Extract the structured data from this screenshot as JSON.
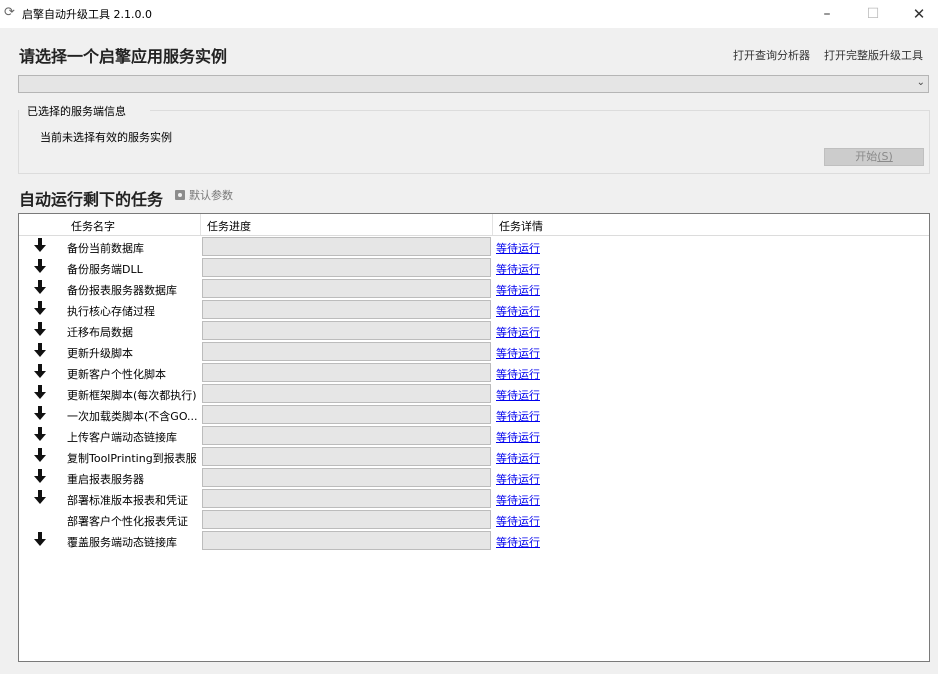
{
  "window": {
    "title": "启擎自动升级工具 2.1.0.0",
    "minimize": "–",
    "maximize": "☐",
    "close": "✕"
  },
  "header": {
    "title": "请选择一个启擎应用服务实例",
    "link_query": "打开查询分析器",
    "link_full": "打开完整版升级工具"
  },
  "instance_select": {
    "value": "",
    "arrow": "⌄"
  },
  "server_info": {
    "group_title": "已选择的服务端信息",
    "message": "当前未选择有效的服务实例"
  },
  "start_button": {
    "label": "开始",
    "hotkey": "(S)"
  },
  "tasks": {
    "title": "自动运行剩下的任务",
    "param_button": "默认参数",
    "columns": [
      "任务名字",
      "任务进度",
      "任务详情"
    ],
    "rows": [
      {
        "name": "备份当前数据库",
        "progress": 0,
        "detail": "等待运行",
        "arrow": true
      },
      {
        "name": "备份服务端DLL",
        "progress": 0,
        "detail": "等待运行",
        "arrow": true
      },
      {
        "name": "备份报表服务器数据库",
        "progress": 0,
        "detail": "等待运行",
        "arrow": true
      },
      {
        "name": "执行核心存储过程",
        "progress": 0,
        "detail": "等待运行",
        "arrow": true
      },
      {
        "name": "迁移布局数据",
        "progress": 0,
        "detail": "等待运行",
        "arrow": true
      },
      {
        "name": "更新升级脚本",
        "progress": 0,
        "detail": "等待运行",
        "arrow": true
      },
      {
        "name": "更新客户个性化脚本",
        "progress": 0,
        "detail": "等待运行",
        "arrow": true
      },
      {
        "name": "更新框架脚本(每次都执行)",
        "progress": 0,
        "detail": "等待运行",
        "arrow": true
      },
      {
        "name": "一次加载类脚本(不含GO...",
        "progress": 0,
        "detail": "等待运行",
        "arrow": true
      },
      {
        "name": "上传客户端动态链接库",
        "progress": 0,
        "detail": "等待运行",
        "arrow": true
      },
      {
        "name": "复制ToolPrinting到报表服...",
        "progress": 0,
        "detail": "等待运行",
        "arrow": true
      },
      {
        "name": "重启报表服务器",
        "progress": 0,
        "detail": "等待运行",
        "arrow": true
      },
      {
        "name": "部署标准版本报表和凭证",
        "progress": 0,
        "detail": "等待运行",
        "arrow": true
      },
      {
        "name": "部署客户个性化报表凭证",
        "progress": 0,
        "detail": "等待运行",
        "arrow": false
      },
      {
        "name": "覆盖服务端动态链接库",
        "progress": 0,
        "detail": "等待运行",
        "arrow": true
      }
    ]
  },
  "icons": {
    "app": "refresh-icon",
    "arrow": "arrow-down-icon",
    "param": "gear-icon"
  },
  "colors": {
    "link": "#0000ee",
    "progress_bg": "#e6e6e6",
    "window_bg": "#f0f0f0"
  }
}
